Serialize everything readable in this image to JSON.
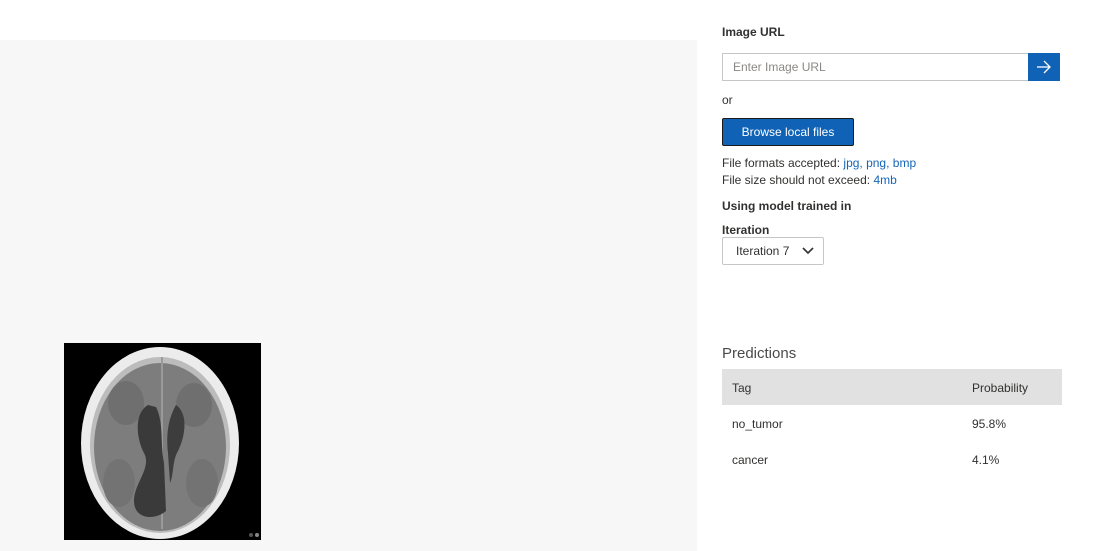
{
  "image_url": {
    "label": "Image URL",
    "placeholder": "Enter Image URL",
    "value": "",
    "go_icon": "arrow-right-icon"
  },
  "or_text": "or",
  "browse_label": "Browse local files",
  "file_formats": {
    "label": "File formats accepted:",
    "value": "jpg, png, bmp"
  },
  "file_size": {
    "label": "File size should not exceed:",
    "value": "4mb"
  },
  "model_heading": "Using model trained in",
  "iteration": {
    "label": "Iteration",
    "selected": "Iteration 7",
    "icon": "chevron-down-icon"
  },
  "predictions": {
    "title": "Predictions",
    "columns": [
      "Tag",
      "Probability"
    ],
    "rows": [
      {
        "tag": "no_tumor",
        "probability": "95.8%"
      },
      {
        "tag": "cancer",
        "probability": "4.1%"
      }
    ]
  },
  "colors": {
    "accent": "#0f62b5",
    "link": "#1565b8",
    "preview_bg": "#f7f7f7",
    "table_header_bg": "#e1e1e1"
  }
}
